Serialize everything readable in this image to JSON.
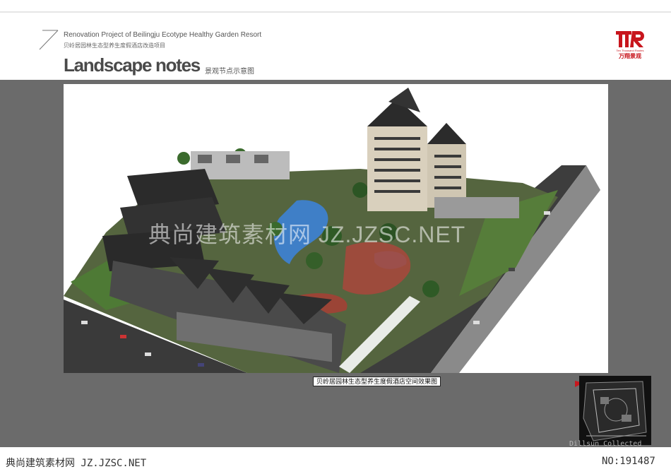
{
  "header": {
    "subtitle_en": "Renovation Project of Beilingju Ecotype Healthy Garden Resort",
    "subtitle_cn": "贝岭居园林生态型养生度假酒店改造项目",
    "title": "Landscape notes",
    "title_cn": "景观节点示意图"
  },
  "logo": {
    "mark": "TR",
    "small_text": "Ten Thousand Routes",
    "cn": "万翔景观",
    "color": "#c8161d"
  },
  "render": {
    "caption": "贝岭居园林生态型养生度假酒店空间效果图"
  },
  "minimap": {
    "credit": "Dillsun Collected"
  },
  "watermarks": {
    "center": "典尚建筑素材网 JZ.JZSC.NET",
    "footer_left": "典尚建筑素材网 JZ.JZSC.NET",
    "footer_right": "NO:191487"
  },
  "colors": {
    "panel": "#6b6b6b",
    "accent": "#c8161d"
  }
}
